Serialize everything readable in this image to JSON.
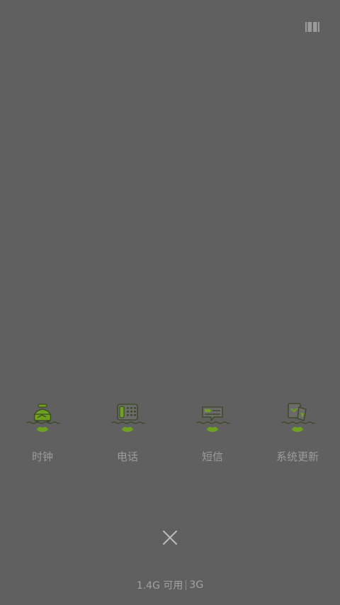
{
  "shortcuts": [
    {
      "label": "时钟",
      "icon": "alarm-clock-icon"
    },
    {
      "label": "电话",
      "icon": "phone-icon"
    },
    {
      "label": "短信",
      "icon": "message-icon"
    },
    {
      "label": "系统更新",
      "icon": "system-update-icon"
    }
  ],
  "memory": {
    "available": "1.4G 可用",
    "network": "3G"
  },
  "icons": {
    "layout_toggle": "layout-toggle-icon",
    "close": "close-icon"
  },
  "colors": {
    "background": "#606060",
    "accent_green": "#6ea21e",
    "icon_outline": "#3f4a2a",
    "label_text": "#9c9c9c"
  }
}
